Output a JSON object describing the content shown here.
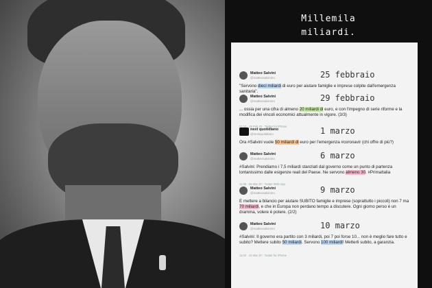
{
  "story": {
    "title_line1": "Millemila",
    "title_line2": "miliardi."
  },
  "tweets": [
    {
      "author": "Matteo Salvini",
      "handle": "@matteosalvinimi",
      "date": "25 febbraio",
      "text_before": "\"Servono ",
      "highlight": "dieci miliardi",
      "text_after": " di euro per aiutare famiglie e imprese colpite dall'emergenza sanitaria\".",
      "highlight_color": "#bcd6f2"
    },
    {
      "author": "Matteo Salvini",
      "handle": "@matteosalvinimi",
      "date": "29 febbraio",
      "text_before": "... ossia per una cifra di almeno ",
      "highlight": "20 miliardi di",
      "text_after": " euro, e con l'impegno di serie riforme e la modifica dei vincoli economici attualmente in vigore. (3/3)",
      "meta": "21:13 · 29 Feb 20 · Twitter for iPhone",
      "highlight_color": "#c6e6a8"
    },
    {
      "author": "next quotidiano",
      "handle": "@nextquotidiano",
      "date": "1 marzo",
      "text_before": "Ora #Salvini vuole ",
      "highlight": "50 miliardi di",
      "text_after": " euro per l'emergenza #coronavir (chi offre di più?)",
      "highlight_color": "#f7c59a"
    },
    {
      "author": "Matteo Salvini",
      "handle": "@matteosalvinimi",
      "date": "6 marzo",
      "text_before": "#Salvini: Prendiamo i 7,5 miliardi stanziati dal governo come un punto di partenza lontanissimo dalle esigenze reali del Paese. Ne servono ",
      "highlight": "almeno 30",
      "text_after": ". #PrimaItalia",
      "meta": "11:38 · 06 Mar 20 · Twitter Web App",
      "highlight_color": "#f3b8cc"
    },
    {
      "author": "Matteo Salvini",
      "handle": "@matteosalvinimi",
      "date": "9 marzo",
      "text_before": "E mettere a bilancio per aiutare SUBITO famiglie e imprese (soprattutto i piccoli) non 7 ma ",
      "highlight": "70 miliardi",
      "text_after": ", e che in Europa non perdano tempo a discutere. Ogni giorno perso è un dramma, volere è potere. (2/2)",
      "highlight_color": "#f3b8cc"
    },
    {
      "author": "Matteo Salvini",
      "handle": "@matteosalvinimi",
      "date": "10 marzo",
      "text_before": "#Salvini: Il governo era partito con 3 miliardi, poi 7 poi forse 10... non è meglio fare tutto e subito? Mettere subito ",
      "highlight": "50 miliardi",
      "text_mid": ". Servono ",
      "highlight2": "100 miliardi",
      "text_after": "! Metterli subito, a garanzia.",
      "meta": "11:02 · 10 Mar 20 · Twitter for iPhone",
      "highlight_color": "#bcd6f2"
    }
  ]
}
